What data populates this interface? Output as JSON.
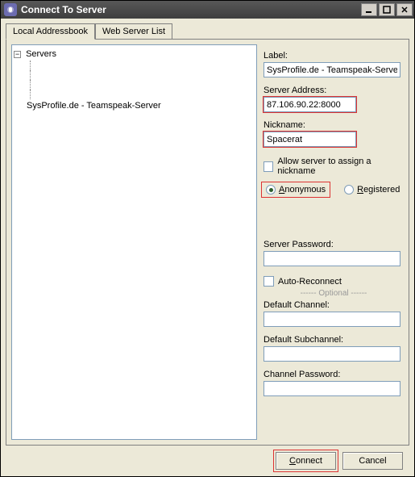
{
  "window": {
    "title": "Connect To Server"
  },
  "tabs": {
    "local": "Local Addressbook",
    "web": "Web Server List"
  },
  "tree": {
    "root": "Servers",
    "leaf": "SysProfile.de - Teamspeak-Server"
  },
  "form": {
    "label_label": "Label:",
    "label_value": "SysProfile.de - Teamspeak-Server",
    "address_label": "Server Address:",
    "address_value": "87.106.90.22:8000",
    "nickname_label": "Nickname:",
    "nickname_value": "Spacerat",
    "allow_assign": "Allow server to assign a nickname",
    "anonymous": "Anonymous",
    "registered": "Registered",
    "server_pw_label": "Server Password:",
    "server_pw_value": "",
    "auto_reconnect": "Auto-Reconnect",
    "optional_divider": "------ Optional ------",
    "default_channel_label": "Default Channel:",
    "default_channel_value": "",
    "default_subchannel_label": "Default Subchannel:",
    "default_subchannel_value": "",
    "channel_pw_label": "Channel Password:",
    "channel_pw_value": ""
  },
  "buttons": {
    "connect": "Connect",
    "cancel": "Cancel"
  }
}
